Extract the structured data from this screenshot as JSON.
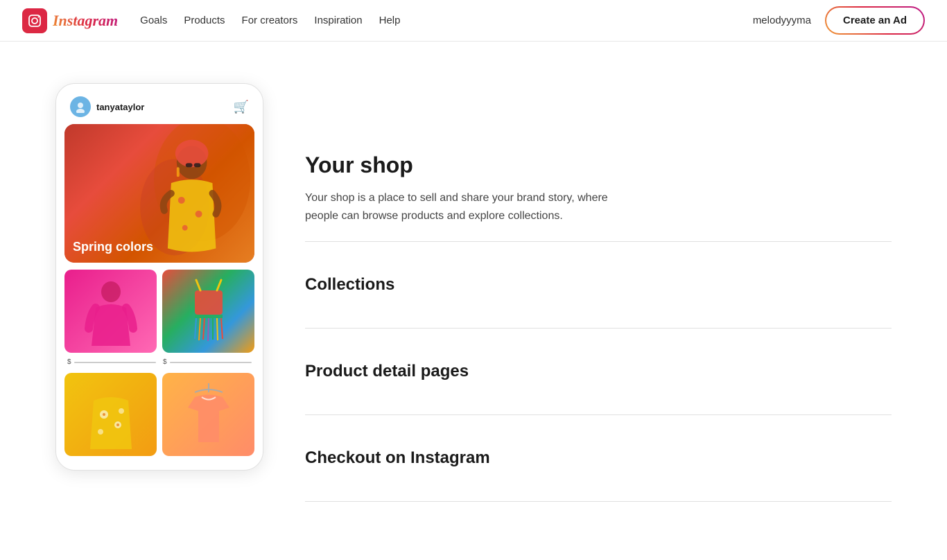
{
  "nav": {
    "logo_text": "Instagram",
    "links": [
      "Goals",
      "Products",
      "For creators",
      "Inspiration",
      "Help"
    ],
    "username": "melodyyyma",
    "cta_label": "Create an Ad"
  },
  "phone": {
    "username": "tanyataylor",
    "hero_label": "Spring colors"
  },
  "right": {
    "heading": "Your shop",
    "description": "Your shop is a place to sell and share your brand story, where people can browse products and explore collections.",
    "features": [
      {
        "title": "Collections"
      },
      {
        "title": "Product detail pages"
      },
      {
        "title": "Checkout on Instagram"
      }
    ]
  }
}
